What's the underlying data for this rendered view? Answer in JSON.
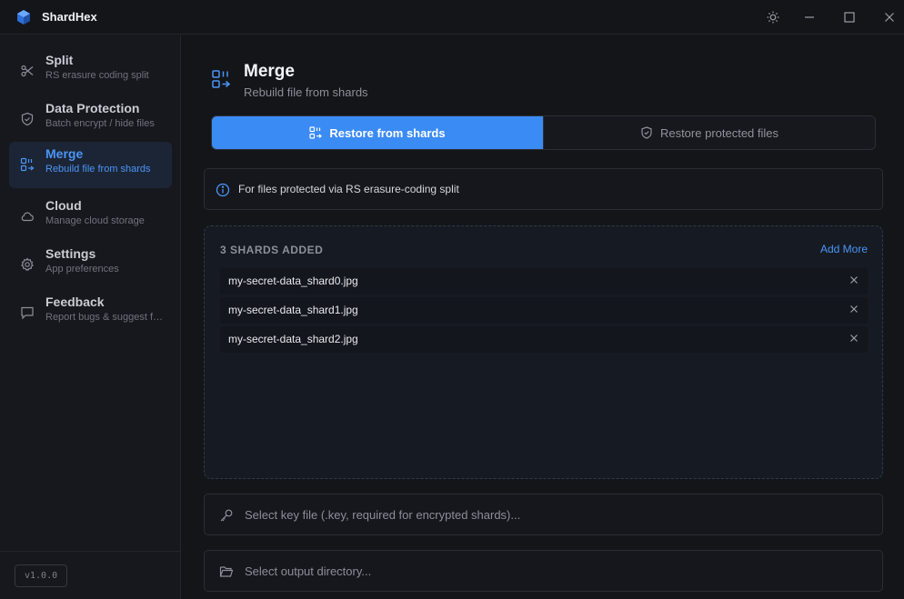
{
  "app": {
    "title": "ShardHex"
  },
  "sidebar": {
    "items": [
      {
        "label": "Split",
        "sub": "RS erasure coding split",
        "icon": "scissors-icon"
      },
      {
        "label": "Data Protection",
        "sub": "Batch encrypt / hide files",
        "icon": "shield-icon"
      },
      {
        "label": "Merge",
        "sub": "Rebuild file from shards",
        "icon": "merge-icon"
      },
      {
        "label": "Cloud",
        "sub": "Manage cloud storage",
        "icon": "cloud-icon"
      },
      {
        "label": "Settings",
        "sub": "App preferences",
        "icon": "gear-icon"
      },
      {
        "label": "Feedback",
        "sub": "Report bugs & suggest features",
        "icon": "message-icon"
      }
    ],
    "version": "v1.0.0"
  },
  "page": {
    "title": "Merge",
    "subtitle": "Rebuild file from shards"
  },
  "modes": {
    "primary": "Restore from shards",
    "secondary": "Restore protected files"
  },
  "info": {
    "text": "For files protected via RS erasure-coding split"
  },
  "shards": {
    "count_label": "3 SHARDS ADDED",
    "add_more": "Add More",
    "files": [
      "my-secret-data_shard0.jpg",
      "my-secret-data_shard1.jpg",
      "my-secret-data_shard2.jpg"
    ]
  },
  "key_field": {
    "placeholder": "Select key file (.key, required for encrypted shards)..."
  },
  "output_field": {
    "placeholder": "Select output directory..."
  },
  "colors": {
    "accent": "#3b8bf5",
    "background": "#141519",
    "sidebar": "#17181d"
  }
}
